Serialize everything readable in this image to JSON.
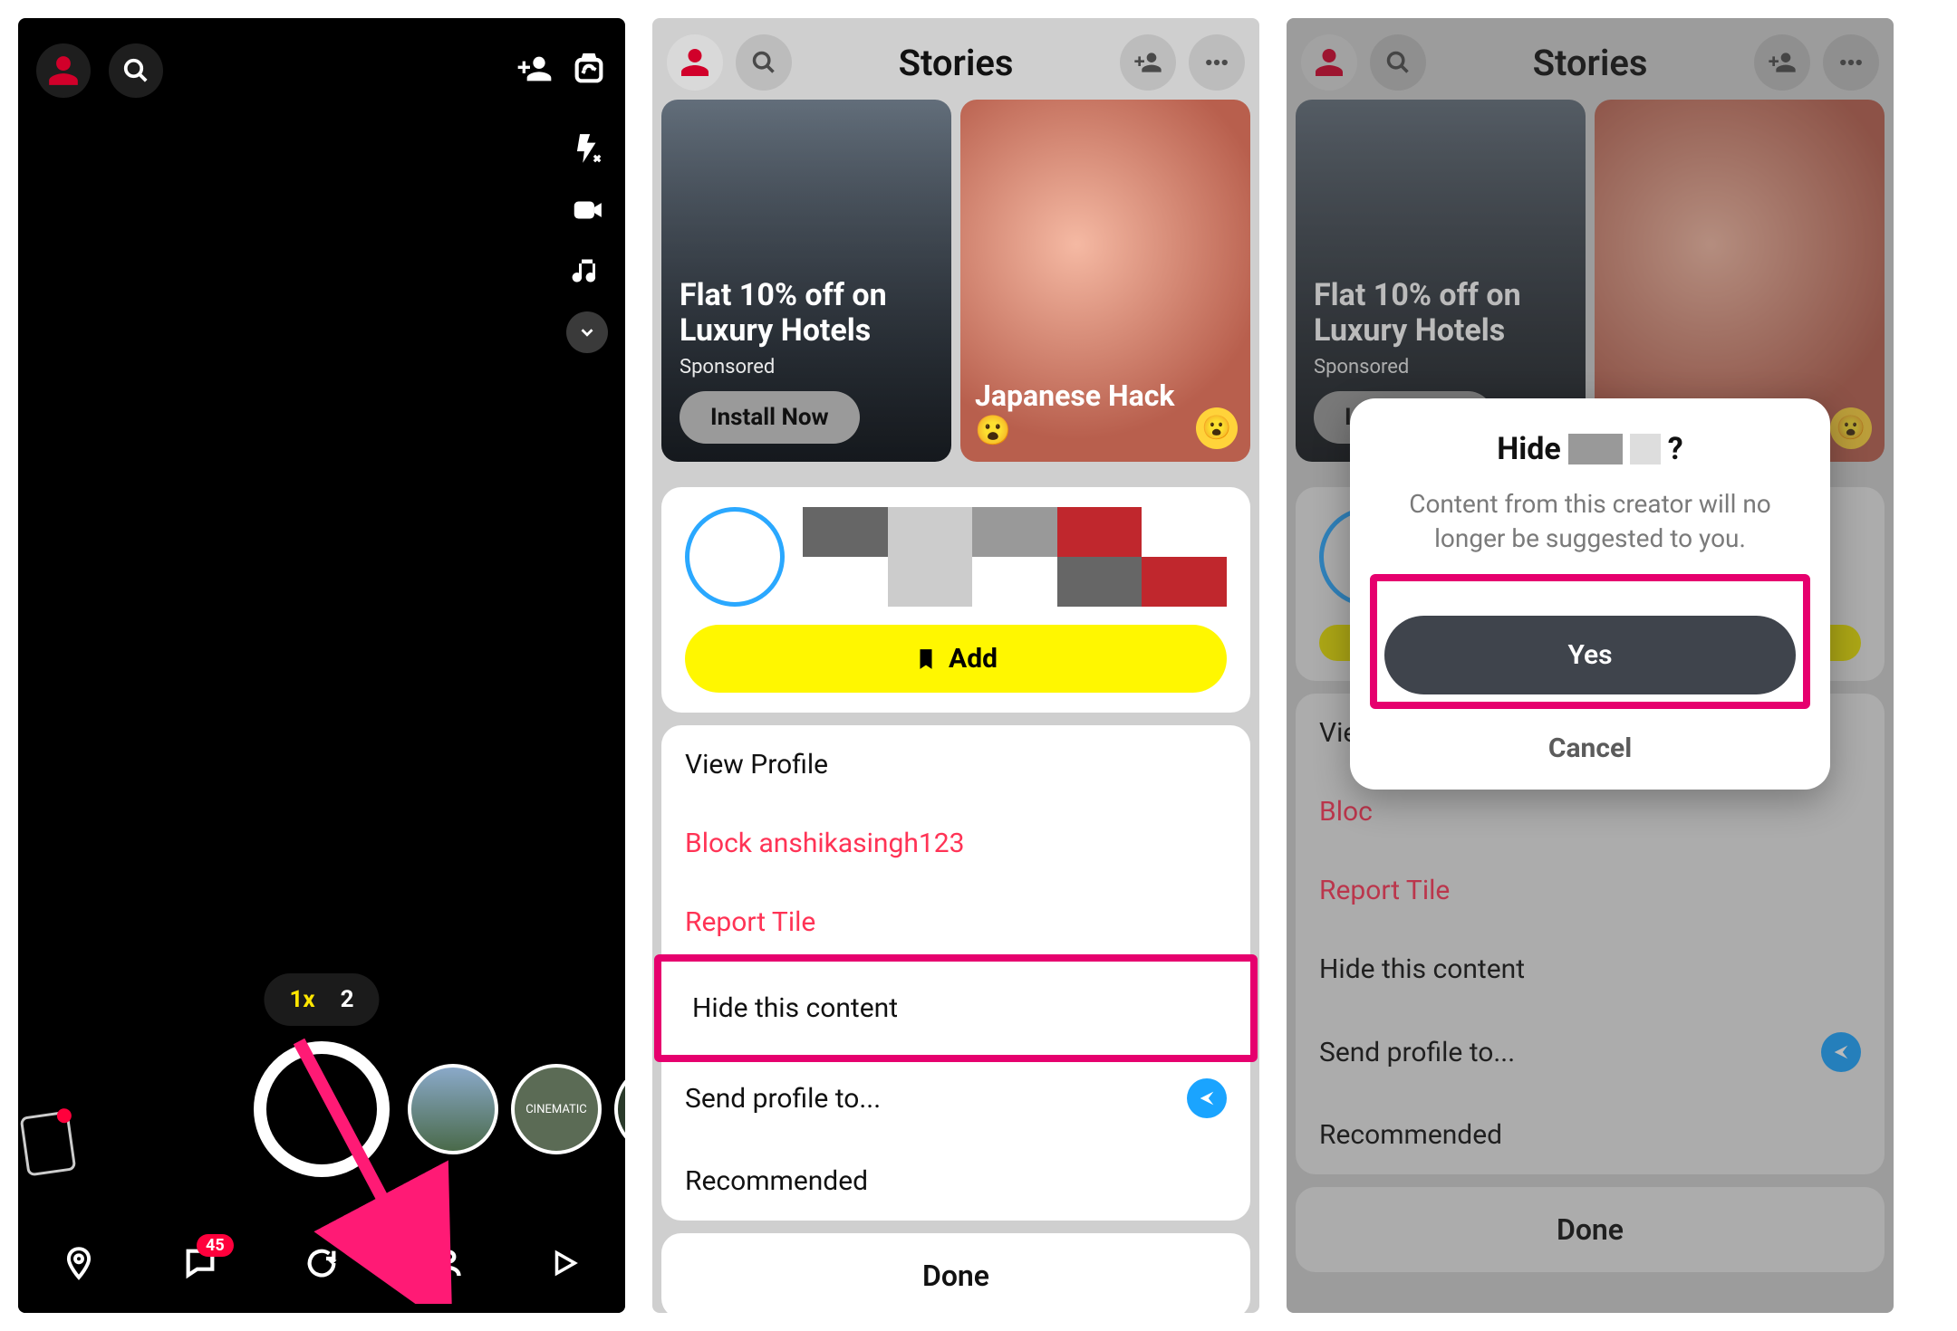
{
  "camera": {
    "zoom_active": "1x",
    "zoom_inactive": "2",
    "chat_badge": "45",
    "lens2_label": "CINEMATIC"
  },
  "stories": {
    "title": "Stories",
    "tile_hotel": {
      "title": "Flat 10% off on Luxury Hotels",
      "sub": "Sponsored",
      "cta": "Install Now"
    },
    "tile_hack": {
      "title": "Japanese Hack 😮"
    }
  },
  "sheet": {
    "add_button": "Add",
    "view_profile": "View Profile",
    "block_user": "Block anshikasingh123",
    "report_tile": "Report Tile",
    "hide_content": "Hide this content",
    "send_profile": "Send profile to...",
    "recommended": "Recommended",
    "done": "Done"
  },
  "alert": {
    "title_prefix": "Hide",
    "title_suffix": "?",
    "body": "Content from this creator will no longer be suggested to you.",
    "yes": "Yes",
    "cancel": "Cancel"
  }
}
